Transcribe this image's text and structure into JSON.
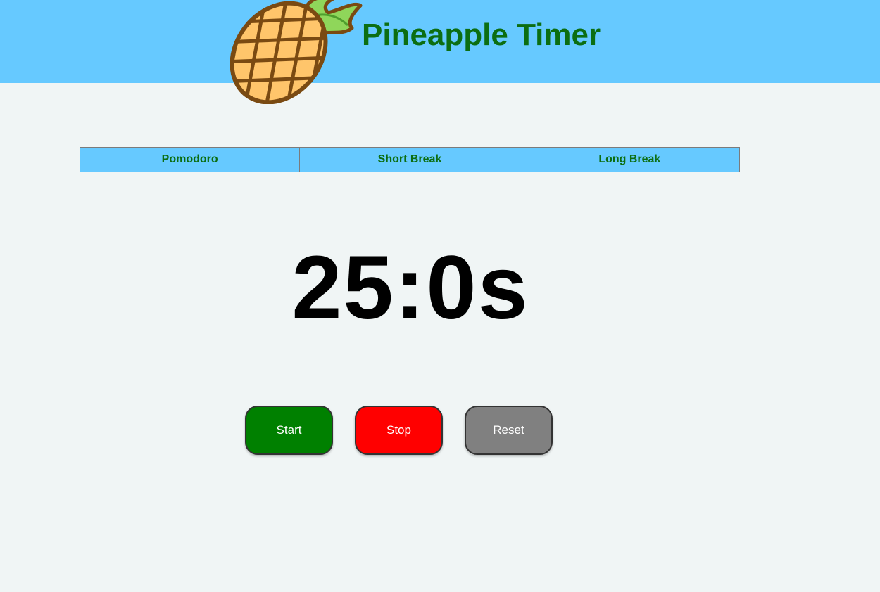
{
  "app": {
    "title": "Pineapple Timer"
  },
  "modes": [
    {
      "label": "Pomodoro"
    },
    {
      "label": "Short Break"
    },
    {
      "label": "Long Break"
    }
  ],
  "timer": {
    "display": "25:0s"
  },
  "controls": {
    "start_label": "Start",
    "stop_label": "Stop",
    "reset_label": "Reset"
  },
  "colors": {
    "header_bg": "#66c9ff",
    "title_text": "#0c6e12",
    "page_bg": "#f0f5f5",
    "start_button": "#008000",
    "stop_button": "#ff0000",
    "reset_button": "#808080"
  },
  "icons": {
    "logo": "pineapple-icon"
  }
}
